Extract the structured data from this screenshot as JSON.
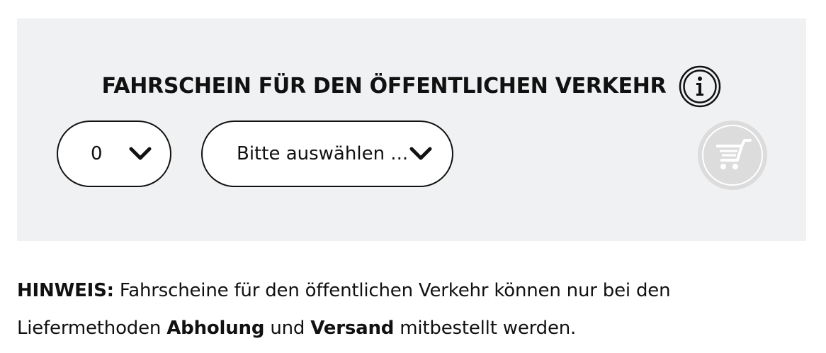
{
  "ticket_panel": {
    "title": "FAHRSCHEIN FÜR DEN ÖFFENTLICHEN VERKEHR",
    "info_icon": "info-icon",
    "quantity_select": {
      "selected": "0",
      "icon": "chevron-down-icon"
    },
    "type_select": {
      "selected": "Bitte auswählen ...",
      "icon": "chevron-down-icon"
    },
    "cart_button": {
      "icon": "cart-icon",
      "state": "disabled",
      "color": "#dcdcdc"
    },
    "background_color": "#f0f1f2"
  },
  "note": {
    "label": "HINWEIS:",
    "text_1": " Fahrscheine für den öffentlichen Verkehr können nur bei den Liefermethoden ",
    "method_1": "Abholung",
    "text_2": " und ",
    "method_2": "Versand",
    "text_3": " mitbestellt werden."
  }
}
